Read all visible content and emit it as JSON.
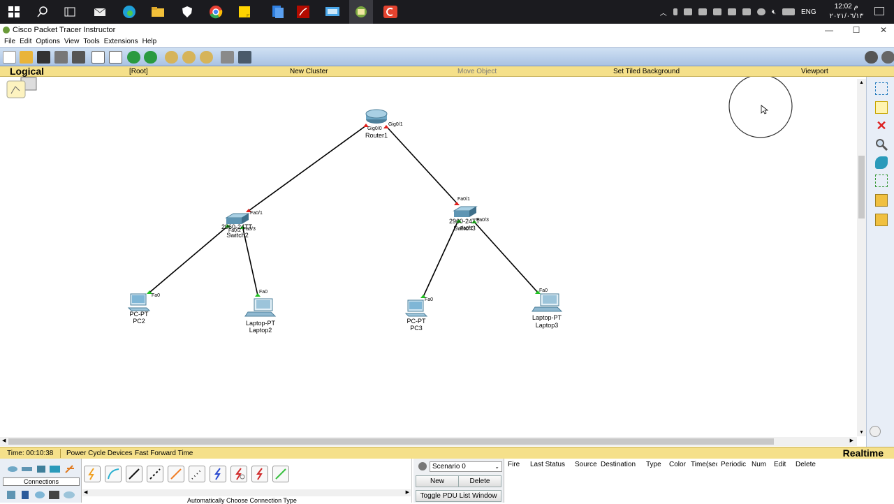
{
  "taskbar": {
    "time": "12:02 م",
    "date": "٢٠٢١/٠٦/١٣",
    "lang": "ENG"
  },
  "window": {
    "title": "Cisco Packet Tracer Instructor",
    "minimize": "—",
    "maximize": "☐",
    "close": "✕"
  },
  "menu": [
    "File",
    "Edit",
    "Options",
    "View",
    "Tools",
    "Extensions",
    "Help"
  ],
  "logical_bar": {
    "label": "Logical",
    "root": "[Root]",
    "new_cluster": "New Cluster",
    "move_object": "Move Object",
    "set_tiled_background": "Set Tiled Background",
    "viewport": "Viewport"
  },
  "topology": {
    "router": {
      "type": "",
      "name": "Router1",
      "port_left": "Gig0/0",
      "port_right": "Gig0/1"
    },
    "switch2": {
      "type": "2960-24TT",
      "name": "Switch2",
      "port_up": "Fa0/1",
      "port_left": "Fa0/2",
      "port_right": "Fa0/3"
    },
    "switch3": {
      "type": "2960-24TT",
      "name": "Switch3",
      "port_up": "Fa0/1",
      "port_left": "Fa0/2",
      "port_right": "Fa0/3"
    },
    "pc2": {
      "type": "PC-PT",
      "name": "PC2",
      "port": "Fa0"
    },
    "laptop2": {
      "type": "Laptop-PT",
      "name": "Laptop2",
      "port": "Fa0"
    },
    "pc3": {
      "type": "PC-PT",
      "name": "PC3",
      "port": "Fa0"
    },
    "laptop3": {
      "type": "Laptop-PT",
      "name": "Laptop3",
      "port": "Fa0"
    }
  },
  "status": {
    "time": "Time: 00:10:38",
    "power_cycle": "Power Cycle Devices",
    "fast_forward": "Fast Forward Time",
    "mode": "Realtime"
  },
  "bottom": {
    "connections_label": "Connections",
    "auto_choose": "Automatically Choose Connection Type",
    "scenario": "Scenario 0",
    "new": "New",
    "delete": "Delete",
    "toggle_pdu": "Toggle PDU List Window",
    "pdu_columns": [
      "Fire",
      "Last Status",
      "Source",
      "Destination",
      "Type",
      "Color",
      "Time(sec)",
      "Periodic",
      "Num",
      "Edit",
      "Delete"
    ]
  },
  "colors": {
    "link_up": "#22c022",
    "link_down": "#e0201c",
    "yellow_bar": "#f5e08a"
  }
}
